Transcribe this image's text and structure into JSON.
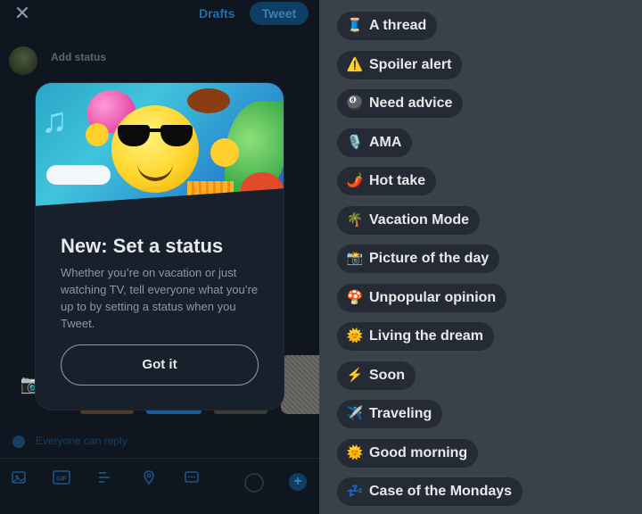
{
  "compose": {
    "close_glyph": "✕",
    "drafts_label": "Drafts",
    "tweet_label": "Tweet",
    "add_status_label": "Add status",
    "reply_setting": "Everyone can reply",
    "toolbar_icons": [
      "image-icon",
      "gif-icon",
      "poll-icon",
      "location-icon",
      "schedule-icon"
    ],
    "gif_label": "GIF",
    "plus_glyph": "+"
  },
  "modal": {
    "title": "New: Set a status",
    "body": "Whether you’re on vacation or just watching TV, tell everyone what you’re up to by setting a status when you Tweet.",
    "button_label": "Got it"
  },
  "statuses": [
    {
      "emoji": "🧵",
      "label": "A thread"
    },
    {
      "emoji": "⚠️",
      "label": "Spoiler alert"
    },
    {
      "emoji": "🎱",
      "label": "Need advice"
    },
    {
      "emoji": "🎙️",
      "label": "AMA"
    },
    {
      "emoji": "🌶️",
      "label": "Hot take"
    },
    {
      "emoji": "🌴",
      "label": "Vacation Mode"
    },
    {
      "emoji": "📸",
      "label": "Picture of the day"
    },
    {
      "emoji": "🍄",
      "label": "Unpopular opinion"
    },
    {
      "emoji": "🌞",
      "label": "Living the dream"
    },
    {
      "emoji": "⚡",
      "label": "Soon"
    },
    {
      "emoji": "✈️",
      "label": "Traveling"
    },
    {
      "emoji": "🌞",
      "label": "Good morning"
    },
    {
      "emoji": "💤",
      "label": "Case of the Mondays"
    }
  ],
  "colors": {
    "accent": "#1d9bf0",
    "pill_bg": "#252b34",
    "panel_bg": "#3b414b"
  }
}
